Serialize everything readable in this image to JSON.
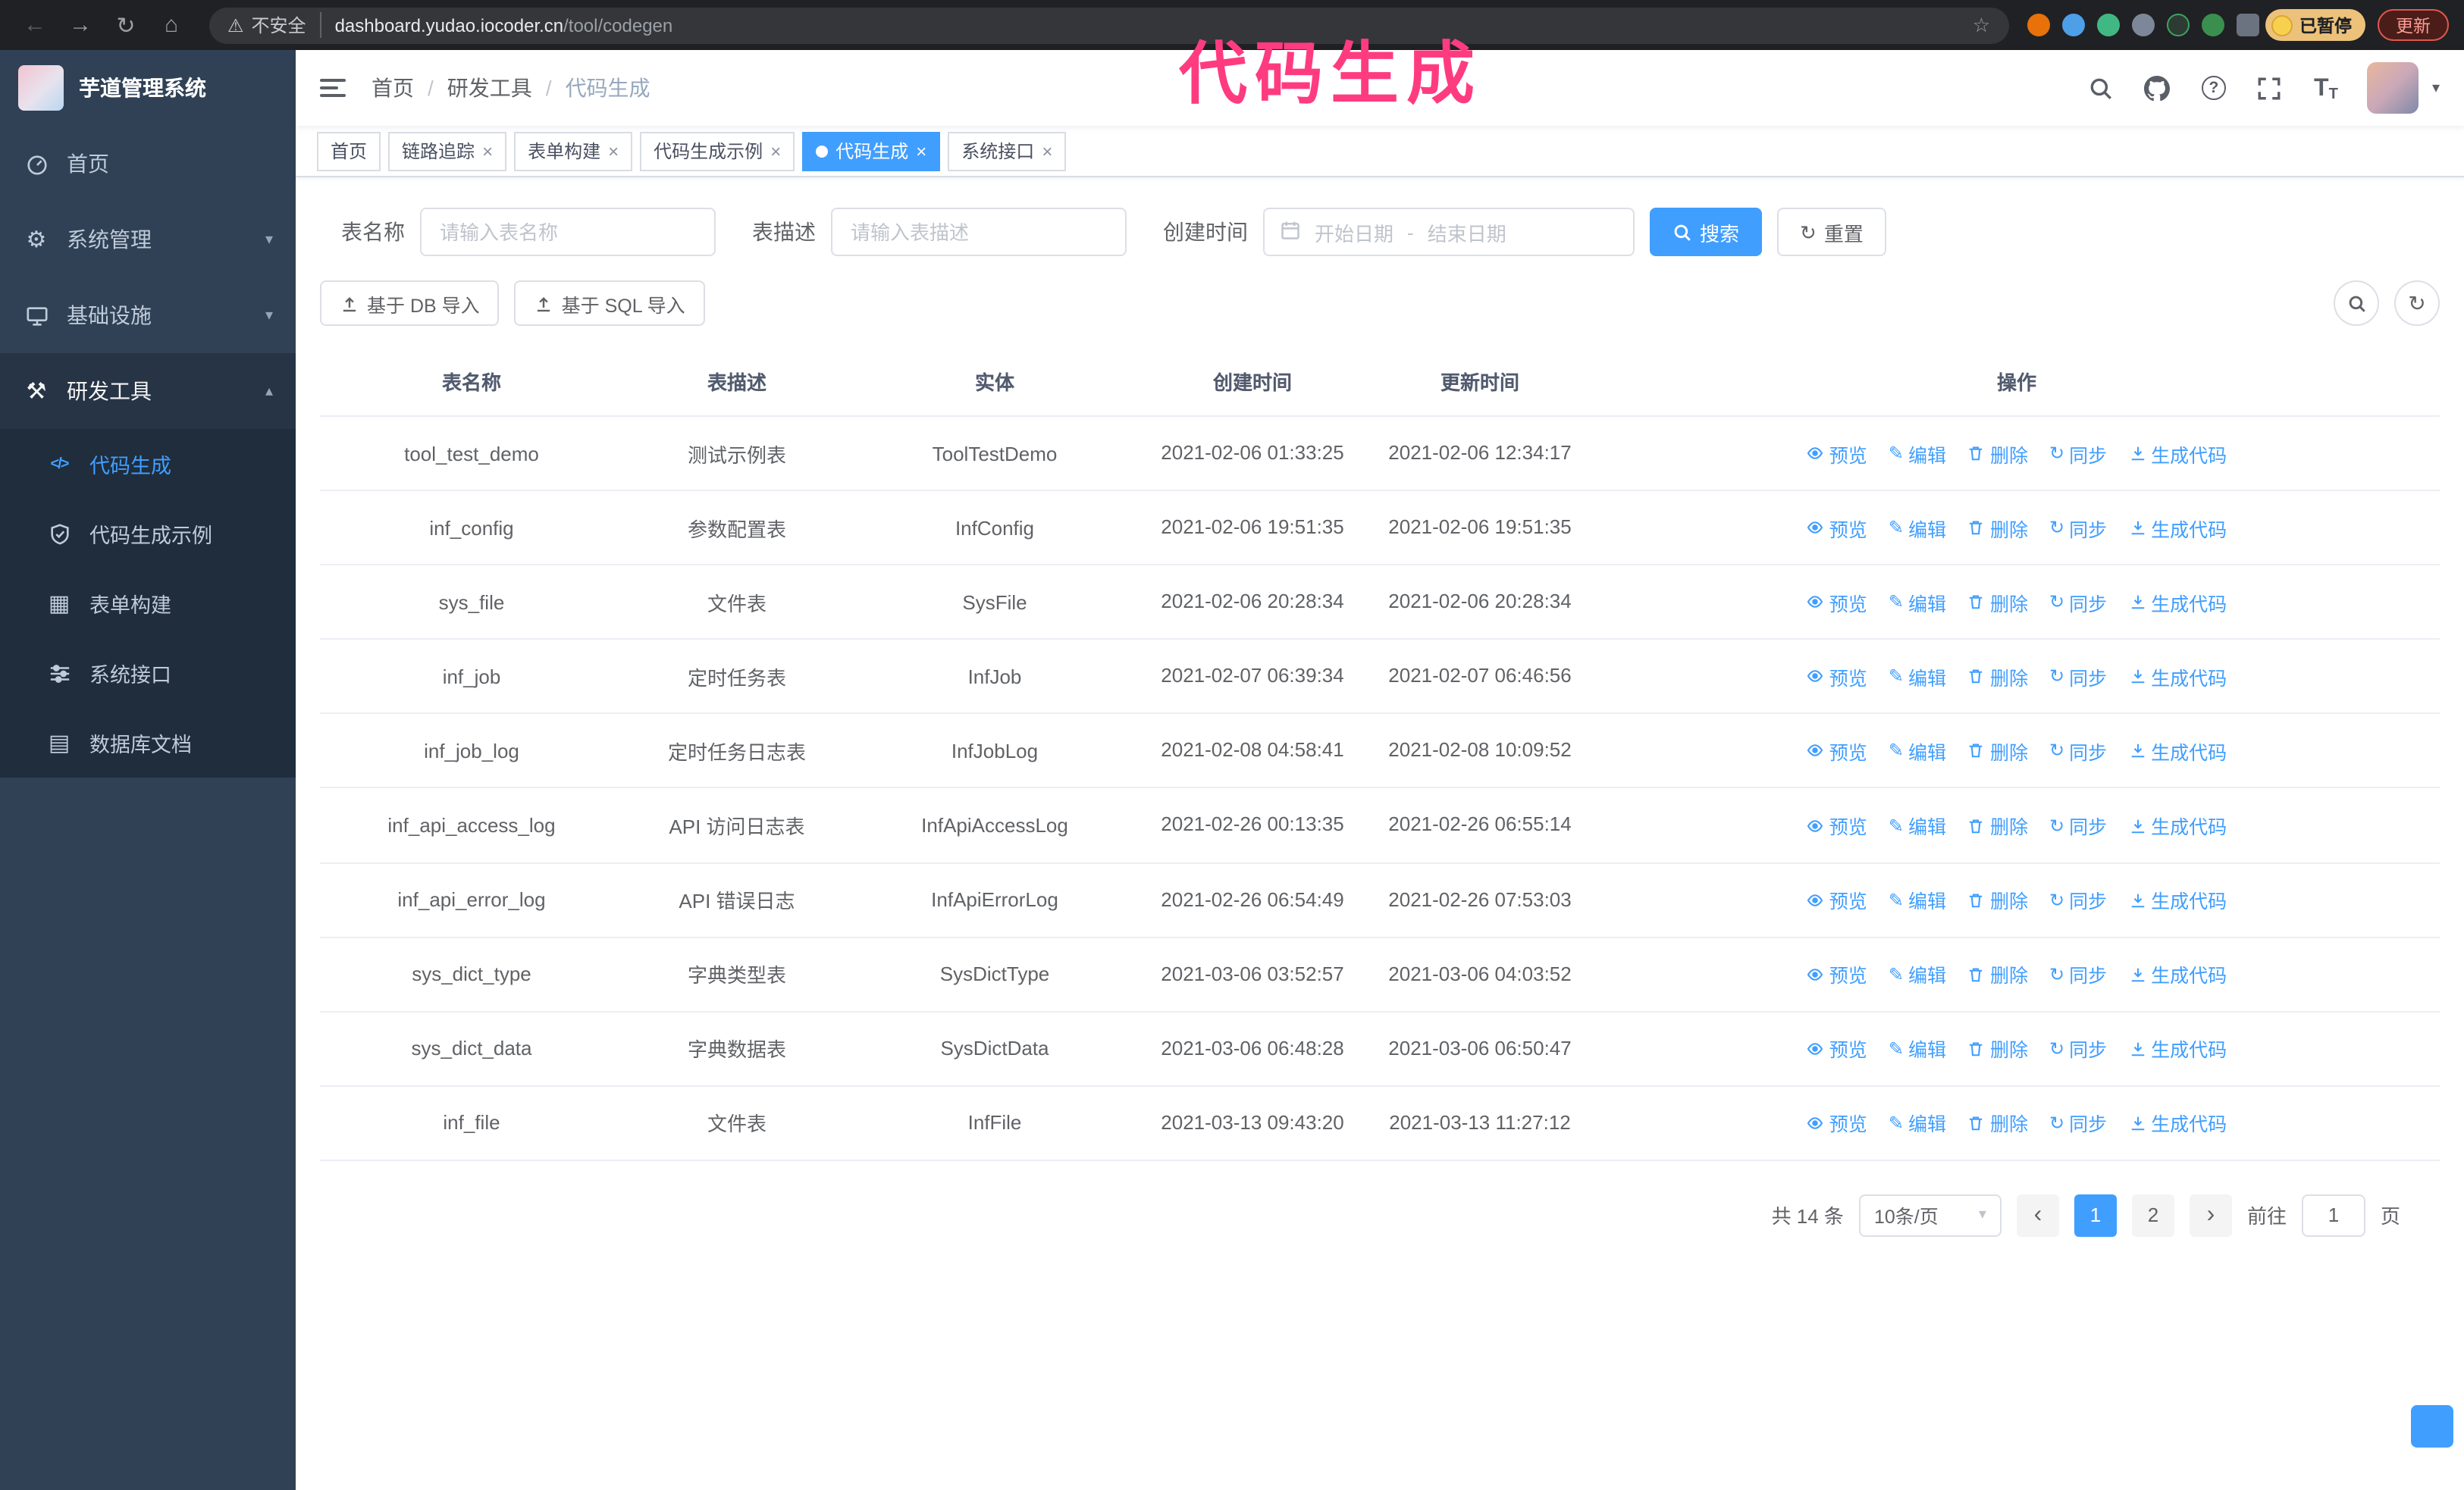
{
  "glyphs": {
    "back": "←",
    "forward": "→",
    "reload": "↻",
    "home": "⌂",
    "warning": "⚠",
    "star": "☆",
    "caret_down": "▾",
    "chevron_down": "▾",
    "chevron_up": "▴",
    "close": "×",
    "edit": "✎",
    "sync": "↻",
    "refresh": "↻",
    "gear": "⚙",
    "tools": "⚒",
    "table_icon": "▦",
    "grid_icon": "▤",
    "code": "</>",
    "help": "?",
    "font_big": "T",
    "font_small": "T",
    "prev": "‹",
    "next": "›"
  },
  "browser": {
    "security_label": "不安全",
    "url_domain": "dashboard.yudao.iocoder.cn",
    "url_path": "/tool/codegen",
    "paused_badge": "已暂停",
    "update_button": "更新"
  },
  "annotation": "代码生成",
  "sidebar": {
    "logo_title": "芋道管理系统",
    "items": [
      {
        "label": "首页"
      },
      {
        "label": "系统管理"
      },
      {
        "label": "基础设施"
      },
      {
        "label": "研发工具"
      }
    ],
    "submenu": [
      {
        "label": "代码生成"
      },
      {
        "label": "代码生成示例"
      },
      {
        "label": "表单构建"
      },
      {
        "label": "系统接口"
      },
      {
        "label": "数据库文档"
      }
    ]
  },
  "breadcrumb": {
    "separator": "/",
    "items": [
      "首页",
      "研发工具",
      "代码生成"
    ]
  },
  "tabs": [
    {
      "label": "首页"
    },
    {
      "label": "链路追踪"
    },
    {
      "label": "表单构建"
    },
    {
      "label": "代码生成示例"
    },
    {
      "label": "代码生成"
    },
    {
      "label": "系统接口"
    }
  ],
  "filters": {
    "table_name_label": "表名称",
    "table_name_placeholder": "请输入表名称",
    "table_desc_label": "表描述",
    "table_desc_placeholder": "请输入表描述",
    "create_time_label": "创建时间",
    "date_start_placeholder": "开始日期",
    "date_separator": "-",
    "date_end_placeholder": "结束日期",
    "search_button": "搜索",
    "reset_button": "重置"
  },
  "toolbar": {
    "import_db": "基于 DB 导入",
    "import_sql": "基于 SQL 导入"
  },
  "table": {
    "columns": [
      "表名称",
      "表描述",
      "实体",
      "创建时间",
      "更新时间",
      "操作"
    ],
    "actions": [
      "预览",
      "编辑",
      "删除",
      "同步",
      "生成代码"
    ],
    "rows": [
      {
        "name": "tool_test_demo",
        "desc": "测试示例表",
        "entity": "ToolTestDemo",
        "created": "2021-02-06 01:33:25",
        "updated": "2021-02-06 12:34:17"
      },
      {
        "name": "inf_config",
        "desc": "参数配置表",
        "entity": "InfConfig",
        "created": "2021-02-06 19:51:35",
        "updated": "2021-02-06 19:51:35"
      },
      {
        "name": "sys_file",
        "desc": "文件表",
        "entity": "SysFile",
        "created": "2021-02-06 20:28:34",
        "updated": "2021-02-06 20:28:34"
      },
      {
        "name": "inf_job",
        "desc": "定时任务表",
        "entity": "InfJob",
        "created": "2021-02-07 06:39:34",
        "updated": "2021-02-07 06:46:56"
      },
      {
        "name": "inf_job_log",
        "desc": "定时任务日志表",
        "entity": "InfJobLog",
        "created": "2021-02-08 04:58:41",
        "updated": "2021-02-08 10:09:52"
      },
      {
        "name": "inf_api_access_log",
        "desc": "API 访问日志表",
        "entity": "InfApiAccessLog",
        "created": "2021-02-26 00:13:35",
        "updated": "2021-02-26 06:55:14"
      },
      {
        "name": "inf_api_error_log",
        "desc": "API 错误日志",
        "entity": "InfApiErrorLog",
        "created": "2021-02-26 06:54:49",
        "updated": "2021-02-26 07:53:03"
      },
      {
        "name": "sys_dict_type",
        "desc": "字典类型表",
        "entity": "SysDictType",
        "created": "2021-03-06 03:52:57",
        "updated": "2021-03-06 04:03:52"
      },
      {
        "name": "sys_dict_data",
        "desc": "字典数据表",
        "entity": "SysDictData",
        "created": "2021-03-06 06:48:28",
        "updated": "2021-03-06 06:50:47"
      },
      {
        "name": "inf_file",
        "desc": "文件表",
        "entity": "InfFile",
        "created": "2021-03-13 09:43:20",
        "updated": "2021-03-13 11:27:12"
      }
    ]
  },
  "pagination": {
    "total": "共 14 条",
    "page_size": "10条/页",
    "pages": [
      "1",
      "2"
    ],
    "goto_label": "前往",
    "goto_value": "1",
    "goto_suffix": "页"
  }
}
